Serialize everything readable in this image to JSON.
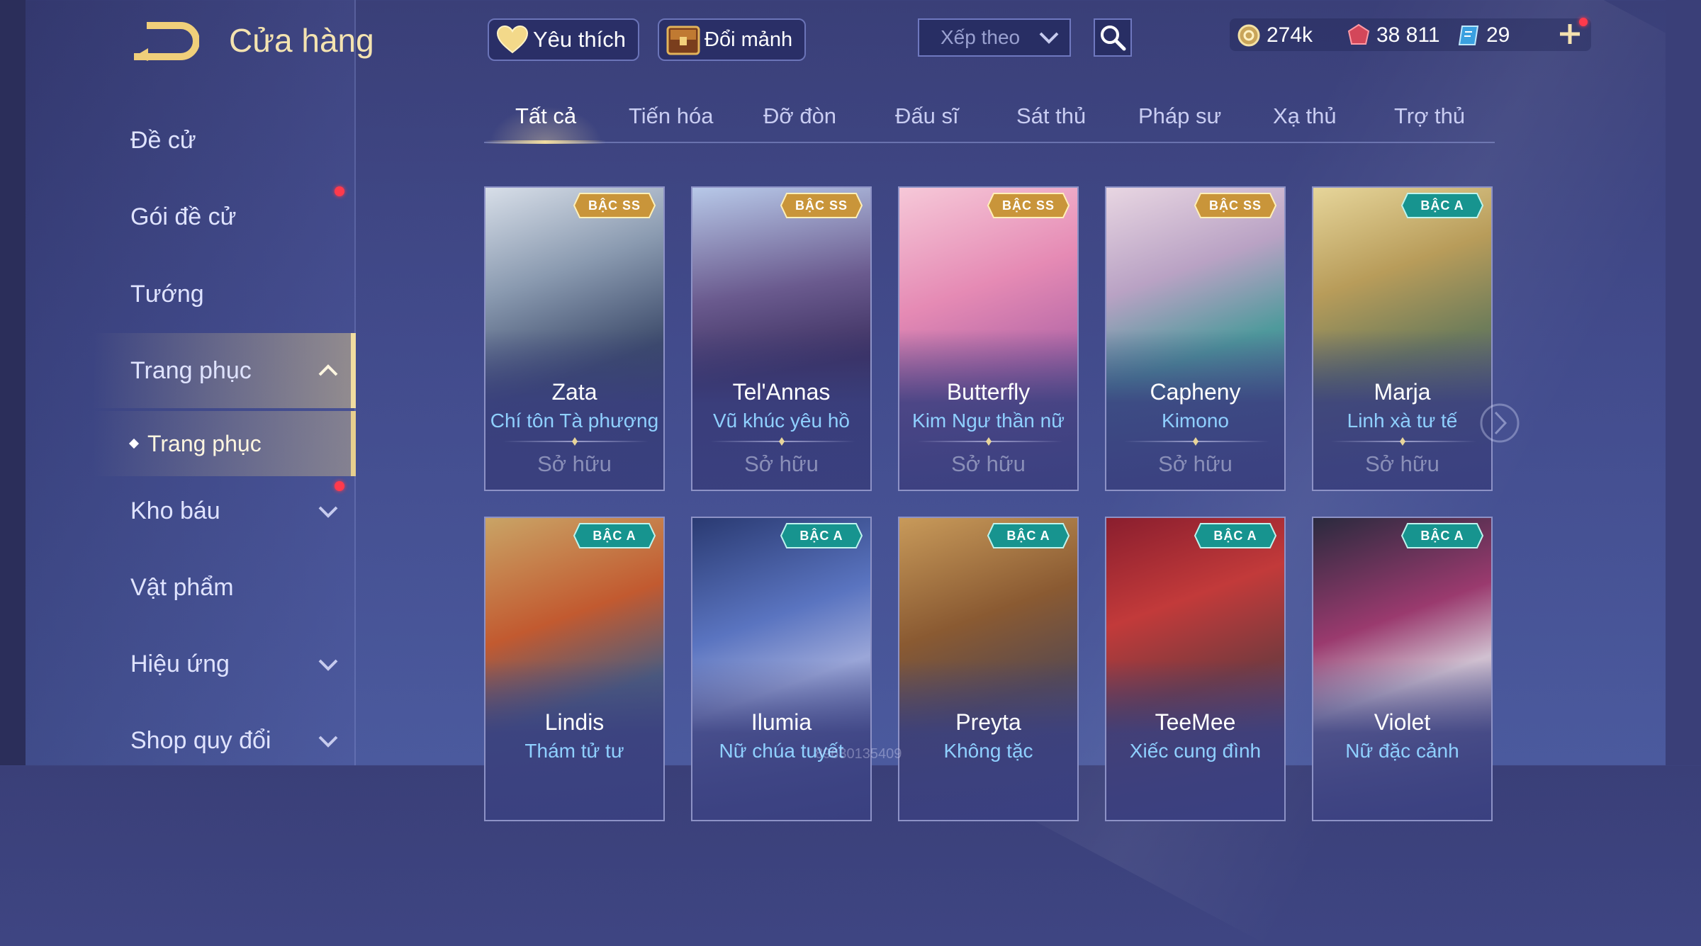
{
  "header": {
    "title": "Cửa hàng"
  },
  "top_bar": {
    "favorite_label": "Yêu thích",
    "exchange_label": "Đổi mảnh",
    "sort_placeholder": "Xếp theo",
    "currencies": [
      {
        "icon": "gold-coin-icon",
        "value": "274k"
      },
      {
        "icon": "red-gem-icon",
        "value": "38 811"
      },
      {
        "icon": "blue-voucher-icon",
        "value": "29"
      }
    ]
  },
  "sidebar": {
    "items": [
      {
        "label": "Đề cử"
      },
      {
        "label": "Gói đề cử",
        "notification": true
      },
      {
        "label": "Tướng"
      },
      {
        "label": "Trang phục",
        "active": true,
        "expanded": true
      },
      {
        "label": "Kho báu",
        "notification": true
      },
      {
        "label": "Vật phẩm"
      },
      {
        "label": "Hiệu ứng"
      },
      {
        "label": "Shop quy đổi"
      }
    ],
    "sub_item": "Trang phục"
  },
  "tabs": [
    "Tất cả",
    "Tiến hóa",
    "Đỡ đòn",
    "Đấu sĩ",
    "Sát thủ",
    "Pháp sư",
    "Xạ thủ",
    "Trợ thủ"
  ],
  "active_tab": "Tất cả",
  "cards": [
    {
      "hero": "Zata",
      "skin": "Chí tôn Tà phượng",
      "tier": "BẬC SS",
      "status": "Sở hữu"
    },
    {
      "hero": "Tel'Annas",
      "skin": "Vũ khúc yêu hồ",
      "tier": "BẬC SS",
      "status": "Sở hữu"
    },
    {
      "hero": "Butterfly",
      "skin": "Kim Ngư thần nữ",
      "tier": "BẬC SS",
      "status": "Sở hữu"
    },
    {
      "hero": "Capheny",
      "skin": "Kimono",
      "tier": "BẬC SS",
      "status": "Sở hữu"
    },
    {
      "hero": "Marja",
      "skin": "Linh xà tư tế",
      "tier": "BẬC A",
      "status": "Sở hữu"
    },
    {
      "hero": "Lindis",
      "skin": "Thám tử tư",
      "tier": "BẬC A"
    },
    {
      "hero": "Ilumia",
      "skin": "Nữ chúa tuyết",
      "tier": "BẬC A"
    },
    {
      "hero": "Preyta",
      "skin": "Không tặc",
      "tier": "BẬC A"
    },
    {
      "hero": "TeeMee",
      "skin": "Xiếc cung đình",
      "tier": "BẬC A"
    },
    {
      "hero": "Violet",
      "skin": "Nữ đặc cảnh",
      "tier": "BẬC A"
    }
  ],
  "watermark": "89630135409",
  "colors": {
    "gold": "#f0dca0",
    "skin_text": "#8fd0ff",
    "notification": "#ff3a4c",
    "tier_ss": "#e0b04a",
    "tier_a": "#1aa8a0"
  }
}
